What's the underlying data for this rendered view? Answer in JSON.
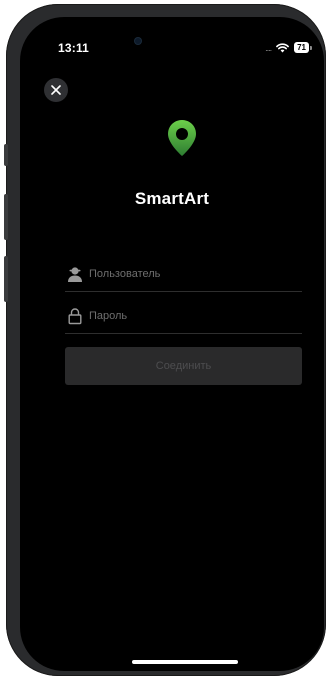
{
  "status_bar": {
    "time": "13:11",
    "signal": "....",
    "battery_level": "71"
  },
  "app": {
    "title": "SmartArt",
    "accent_color": "#4caf50"
  },
  "form": {
    "username_placeholder": "Пользователь",
    "username_value": "",
    "password_placeholder": "Пароль",
    "password_value": "",
    "connect_label": "Соединить"
  },
  "icons": {
    "close": "close-icon",
    "logo": "map-pin-icon",
    "user": "user-icon",
    "lock": "lock-icon",
    "wifi": "wifi-icon",
    "battery": "battery-icon"
  }
}
